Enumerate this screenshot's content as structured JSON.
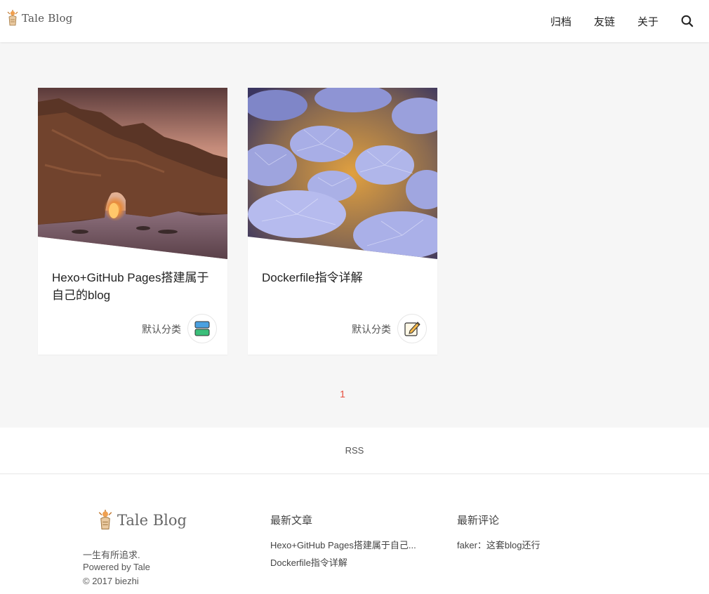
{
  "header": {
    "logo_text": "Tale Blog",
    "nav": [
      "归档",
      "友链",
      "关于"
    ]
  },
  "posts": [
    {
      "title": "Hexo+GitHub Pages搭建属于自己的blog",
      "category": "默认分类",
      "thumbnail": "coastal rock arch at sunset",
      "badge_icon": "stacked-cards-icon"
    },
    {
      "title": "Dockerfile指令详解",
      "category": "默认分类",
      "thumbnail": "frosted grass tufts",
      "badge_icon": "edit-note-icon"
    }
  ],
  "pagination": {
    "current": "1"
  },
  "rss": {
    "label": "RSS"
  },
  "footer": {
    "logo_text": "Tale Blog",
    "tagline": "一生有所追求.",
    "powered": "Powered by Tale",
    "copyright": "© 2017 biezhi",
    "recent_posts_heading": "最新文章",
    "recent_posts": [
      "Hexo+GitHub Pages搭建属于自己...",
      "Dockerfile指令详解"
    ],
    "recent_comments_heading": "最新评论",
    "recent_comments": [
      "faker：这套blog还行"
    ]
  },
  "colors": {
    "accent": "#e64b3c",
    "background": "#f6f6f6"
  }
}
